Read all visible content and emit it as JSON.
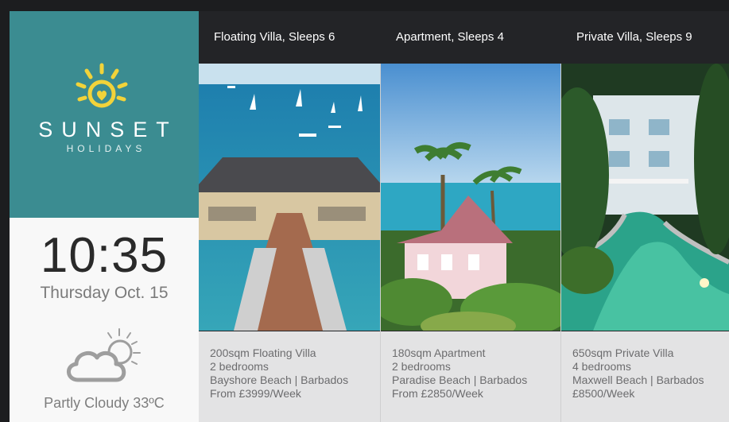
{
  "brand": {
    "name": "SUNSET",
    "subtitle": "HOLIDAYS"
  },
  "clock": {
    "time": "10:35",
    "date": "Thursday Oct. 15"
  },
  "weather": {
    "condition_text": "Partly Cloudy 33ºC",
    "icon": "partly-cloudy-icon"
  },
  "listings": [
    {
      "title": "Floating Villa, Sleeps 6",
      "size": "200sqm Floating Villa",
      "bedrooms": "2 bedrooms",
      "location": "Bayshore Beach | Barbados",
      "price": "From £3999/Week"
    },
    {
      "title": "Apartment, Sleeps 4",
      "size": "180sqm Apartment",
      "bedrooms": "2 bedrooms",
      "location": "Paradise Beach | Barbados",
      "price": "From £2850/Week"
    },
    {
      "title": "Private Villa, Sleeps 9",
      "size": "650sqm Private Villa",
      "bedrooms": "4 bedrooms",
      "location": "Maxwell Beach | Barbados",
      "price": "£8500/Week"
    }
  ],
  "colors": {
    "brand_teal": "#3b8c91",
    "sun_yellow": "#f2d33a",
    "header_dark": "#232427",
    "info_grey": "#e3e3e4"
  }
}
